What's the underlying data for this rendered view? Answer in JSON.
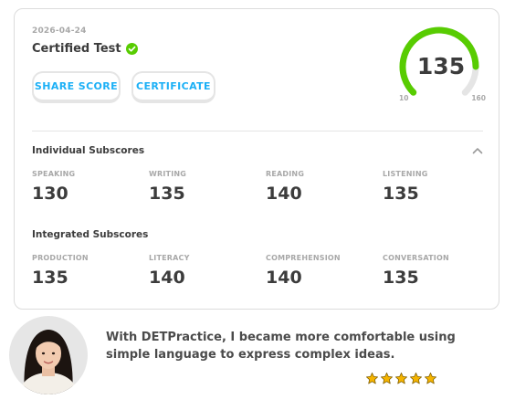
{
  "result_card": {
    "date": "2026-04-24",
    "title": "Certified Test",
    "buttons": {
      "share_label": "SHARE SCORE",
      "certificate_label": "CERTIFICATE"
    },
    "gauge": {
      "score": "135",
      "min": "10",
      "max": "160",
      "fill_fraction": 0.833,
      "fill_color": "#58cc02",
      "track_color": "#e5e5e5"
    },
    "individual": {
      "title": "Individual Subscores",
      "items": [
        {
          "label": "SPEAKING",
          "value": "130"
        },
        {
          "label": "WRITING",
          "value": "135"
        },
        {
          "label": "READING",
          "value": "140"
        },
        {
          "label": "LISTENING",
          "value": "135"
        }
      ]
    },
    "integrated": {
      "title": "Integrated Subscores",
      "items": [
        {
          "label": "PRODUCTION",
          "value": "135"
        },
        {
          "label": "LITERACY",
          "value": "140"
        },
        {
          "label": "COMPREHENSION",
          "value": "140"
        },
        {
          "label": "CONVERSATION",
          "value": "135"
        }
      ]
    }
  },
  "testimonial": {
    "quote_line1": "With DETPractice, I became more comfortable using",
    "quote_line2": "simple language to express complex ideas.",
    "rating": 5,
    "star_color": "#f5b400"
  },
  "icons": {
    "verified": "check-circle-icon",
    "collapse": "chevron-up-icon",
    "rating": "star-icon"
  },
  "colors": {
    "accent_blue": "#1cb0f6",
    "success_green": "#58cc02"
  }
}
